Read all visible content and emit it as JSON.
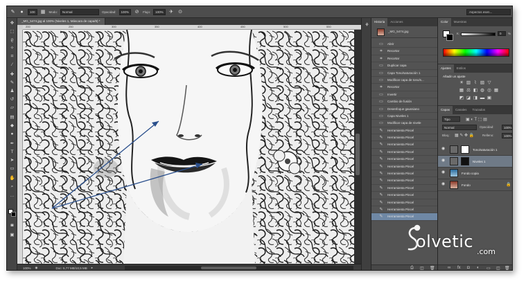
{
  "options_bar": {
    "brush_size": "100",
    "mode_label": "Modo:",
    "mode_value": "Normal",
    "opacity_label": "Opacidad:",
    "opacity_value": "100%",
    "flow_label": "Flujo:",
    "flow_value": "100%",
    "workspace": "Aspectos esen..."
  },
  "document": {
    "tab_title": "_MG_5474.jpg al 100% (Niveles 1, Máscara de capa/8) *",
    "ruler_ticks": [
      "200",
      "250",
      "300",
      "350",
      "400",
      "450",
      "500",
      "550"
    ],
    "status_zoom": "100%",
    "status_doc": "Doc: 5,77 MB/10,5 MB"
  },
  "history": {
    "tabs": [
      "Historia",
      "Acciones"
    ],
    "snapshot": "_MG_5474.jpg",
    "items": [
      {
        "icon": "doc-icon",
        "label": "Abrir"
      },
      {
        "icon": "crop-icon",
        "label": "Recortar"
      },
      {
        "icon": "crop-icon",
        "label": "Recortar"
      },
      {
        "icon": "doc-icon",
        "label": "Duplicar capa"
      },
      {
        "icon": "doc-icon",
        "label": "Capa Tono/saturación 1"
      },
      {
        "icon": "doc-icon",
        "label": "Modificar capa de tono/s..."
      },
      {
        "icon": "crop-icon",
        "label": "Recortar"
      },
      {
        "icon": "doc-icon",
        "label": "Invertir"
      },
      {
        "icon": "doc-icon",
        "label": "Cambio de fusión"
      },
      {
        "icon": "doc-icon",
        "label": "Desenfoque gaussiano"
      },
      {
        "icon": "doc-icon",
        "label": "Capa Niveles 1"
      },
      {
        "icon": "doc-icon",
        "label": "Modificar capa de nivele"
      },
      {
        "icon": "brush-icon",
        "label": "Herramienta Pincel"
      },
      {
        "icon": "brush-icon",
        "label": "Herramienta Pincel"
      },
      {
        "icon": "brush-icon",
        "label": "Herramienta Pincel"
      },
      {
        "icon": "brush-icon",
        "label": "Herramienta Pincel"
      },
      {
        "icon": "brush-icon",
        "label": "Herramienta Pincel"
      },
      {
        "icon": "brush-icon",
        "label": "Herramienta Pincel"
      },
      {
        "icon": "brush-icon",
        "label": "Herramienta Pincel"
      },
      {
        "icon": "brush-icon",
        "label": "Herramienta Pincel"
      },
      {
        "icon": "brush-icon",
        "label": "Herramienta Pincel"
      },
      {
        "icon": "brush-icon",
        "label": "Herramienta Pincel"
      },
      {
        "icon": "brush-icon",
        "label": "Herramienta Pincel"
      },
      {
        "icon": "brush-icon",
        "label": "Herramienta Pincel"
      },
      {
        "icon": "brush-icon",
        "label": "Herramienta Pincel",
        "selected": true
      }
    ]
  },
  "color_panel": {
    "tabs": [
      "Color",
      "Muestras"
    ],
    "k_label": "K",
    "k_value": "0",
    "k_unit": "%"
  },
  "adjustments": {
    "tabs": [
      "Ajustes",
      "Estilos"
    ],
    "title": "Añadir un ajuste"
  },
  "layers": {
    "tabs": [
      "Capas",
      "Canales",
      "Trazados"
    ],
    "kind_filter": "Tipo",
    "blend_mode": "Normal",
    "opacity_label": "Opacidad:",
    "opacity_value": "100%",
    "lock_label": "Bloq.:",
    "fill_label": "Relleno:",
    "fill_value": "100%",
    "items": [
      {
        "name": "Tono/saturación 1",
        "type": "adjustment",
        "selected": false
      },
      {
        "name": "Niveles 1",
        "type": "adjustment",
        "selected": true
      },
      {
        "name": "Fondo copia",
        "type": "image",
        "selected": false
      },
      {
        "name": "Fondo",
        "type": "image",
        "selected": false,
        "locked": true
      }
    ]
  },
  "logo": {
    "text": "olvetic",
    "domain": ".com"
  },
  "colors": {
    "panel_bg": "#535353",
    "selection": "#6f88a5",
    "arrow": "#2a4f8c"
  }
}
